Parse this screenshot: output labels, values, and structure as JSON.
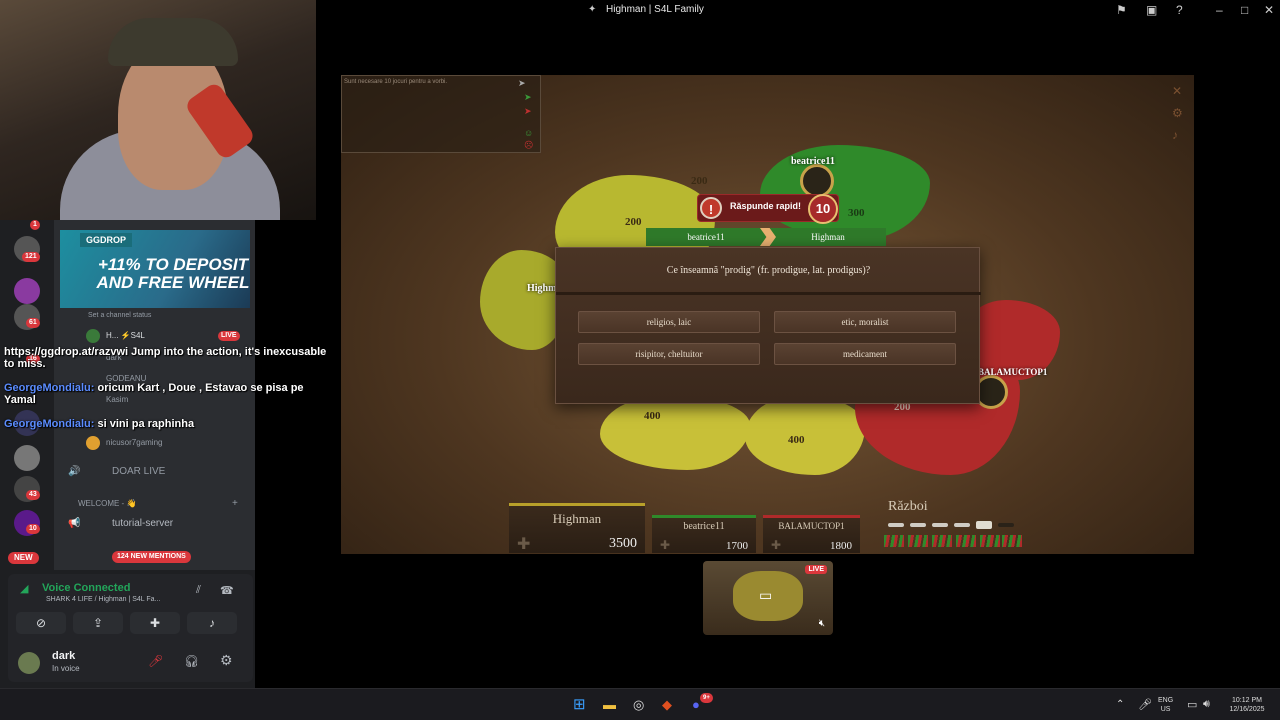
{
  "window": {
    "title": "Highman | S4L Family"
  },
  "chat_overlay": [
    {
      "name": "",
      "text": "https://ggdrop.at/razvwi Jump into the action, it's inexcusable to miss."
    },
    {
      "name": "GeorgeMondialu:",
      "text": "oricum Kart , Doue , Estavao se pisa pe Yamal"
    },
    {
      "name": "GeorgeMondialu:",
      "text": "si vini pa raphinha"
    }
  ],
  "discord": {
    "server_badges": [
      "1",
      "121",
      "61",
      "16",
      "43",
      "10",
      "NEW"
    ],
    "promo": {
      "brand": "GGDROP",
      "headline": "+11% TO DEPOSIT AND FREE WHEEL"
    },
    "channel_status": "Set a channel status",
    "members": [
      {
        "name": "H... ⚡S4L",
        "badge": "LIVE"
      },
      {
        "name": "dark",
        "badge": ""
      },
      {
        "name": "GODEANU",
        "badge": ""
      },
      {
        "name": "Kasim",
        "badge": ""
      },
      {
        "name": "nicusor7gaming",
        "badge": ""
      }
    ],
    "channels": {
      "doar_live": "DOAR LIVE",
      "category": "WELCOME - 👋",
      "tutorial": "tutorial-server",
      "new_mentions": "124 NEW MENTIONS"
    },
    "voice": {
      "connected": "Voice Connected",
      "server": "SHARK 4 LIFE / Highman | S4L Fa...",
      "user": "dark",
      "status": "In voice"
    }
  },
  "game": {
    "chat_hint": "Sunt necesare 10 jocuri pentru a vorbi.",
    "timer_text": "Răspunde rapid!",
    "timer_count": "10",
    "duel_left": "beatrice11",
    "duel_right": "Highman",
    "question": "Ce înseamnă \"prodig\" (fr. prodigue, lat. prodigus)?",
    "answers": [
      "religios, laic",
      "etic, moralist",
      "risipitor, cheltuitor",
      "medicament"
    ],
    "map_labels": {
      "p1": "beatrice11",
      "p2": "Highm",
      "p3": "BALAMUCTOP1"
    },
    "region_values": [
      "200",
      "200",
      "300",
      "400",
      "400",
      "200"
    ],
    "scores": [
      {
        "name": "Highman",
        "points": "3500",
        "color": "#b8a02a"
      },
      {
        "name": "beatrice11",
        "points": "1700",
        "color": "#2f8a2a"
      },
      {
        "name": "BALAMUCTOP1",
        "points": "1800",
        "color": "#b02a2a"
      }
    ],
    "war_label": "Război",
    "preview_live": "LIVE"
  },
  "taskbar": {
    "lang": "ENG",
    "region": "US",
    "time": "10:12 PM",
    "date": "12/16/2025",
    "discord_badge": "9+"
  }
}
